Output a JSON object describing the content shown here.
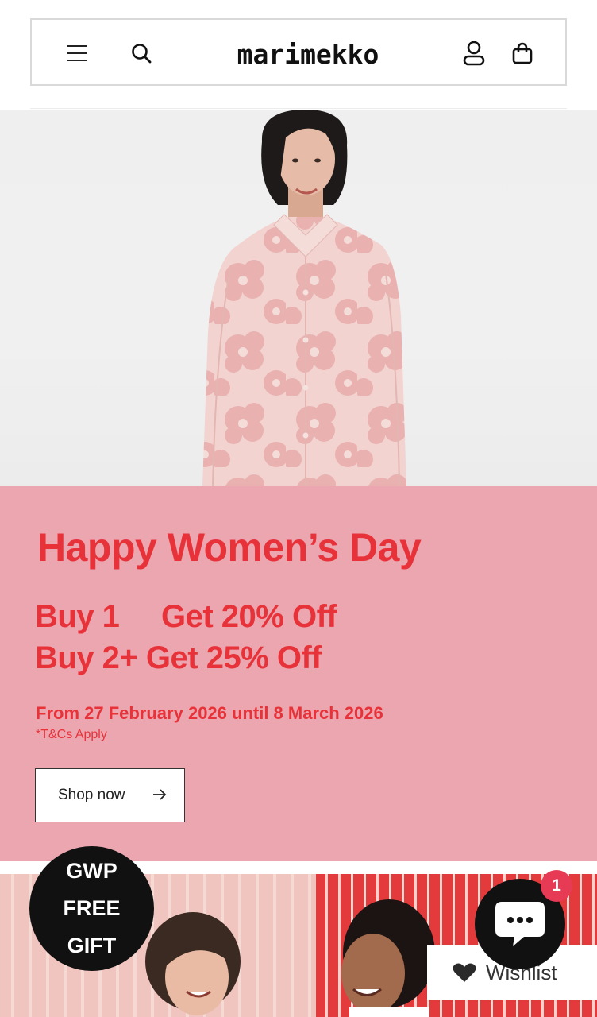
{
  "header": {
    "logo_text": "marimekko",
    "icons": [
      "menu-icon",
      "search-icon",
      "account-icon",
      "cart-icon"
    ]
  },
  "promo": {
    "title": "Happy Women’s Day",
    "offer1_buy": "Buy 1",
    "offer1_deal": "Get 20% Off",
    "offer2": "Buy 2+ Get 25% Off",
    "dates": "From 27 February 2026 until 8 March 2026",
    "tcs": "*T&Cs Apply",
    "cta_label": "Shop now",
    "background": "#eba6af",
    "accent": "#e8323a"
  },
  "gwp": {
    "line1": "GWP",
    "line2": "FREE",
    "line3": "GIFT"
  },
  "chat": {
    "badge_count": "1",
    "badge_color": "#e63a55"
  },
  "wishlist": {
    "label": "Wishlist"
  }
}
